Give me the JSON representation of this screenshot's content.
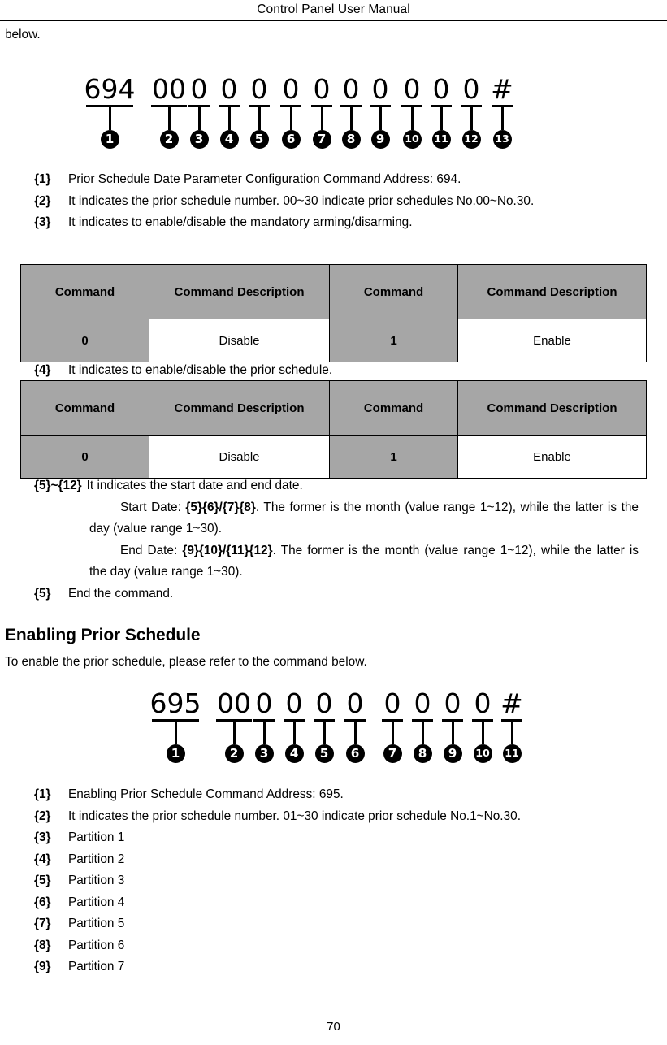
{
  "header": {
    "title": "Control Panel User Manual"
  },
  "intro": {
    "below_text": "below."
  },
  "diagram1": {
    "name": "prior-schedule-date-parameter-command",
    "segments": [
      {
        "digits": "694",
        "marker": "1"
      },
      {
        "digits": "00",
        "marker": "2"
      },
      {
        "digits": "0",
        "marker": "3"
      },
      {
        "digits": "0",
        "marker": "4"
      },
      {
        "digits": "0",
        "marker": "5"
      },
      {
        "digits": "0",
        "marker": "6"
      },
      {
        "digits": "0",
        "marker": "7"
      },
      {
        "digits": "0",
        "marker": "8"
      },
      {
        "digits": "0",
        "marker": "9"
      },
      {
        "digits": "0",
        "marker": "10"
      },
      {
        "digits": "0",
        "marker": "11"
      },
      {
        "digits": "0",
        "marker": "12"
      },
      {
        "digits": "#",
        "marker": "13"
      }
    ]
  },
  "list1": [
    {
      "tag": "{1}",
      "text": "Prior Schedule Date Parameter Configuration Command Address: 694."
    },
    {
      "tag": "{2}",
      "text": "It indicates the prior schedule number. 00~30 indicate prior schedules No.00~No.30."
    },
    {
      "tag": "{3}",
      "text": "It indicates to enable/disable the mandatory arming/disarming."
    }
  ],
  "table1": {
    "headers": [
      "Command",
      "Command Description",
      "Command",
      "Command Description"
    ],
    "rows": [
      [
        "0",
        "Disable",
        "1",
        "Enable"
      ]
    ]
  },
  "list2": [
    {
      "tag": "{4}",
      "text": "It indicates to enable/disable the prior schedule."
    }
  ],
  "table2": {
    "headers": [
      "Command",
      "Command Description",
      "Command",
      "Command Description"
    ],
    "rows": [
      [
        "0",
        "Disable",
        "1",
        "Enable"
      ]
    ]
  },
  "list3": {
    "range_tag": "{5}~{12}",
    "range_text": "It indicates the start date and end date.",
    "start_date_label": "Start Date: ",
    "start_date_codes": "{5}{6}/{7}{8}",
    "start_date_text": ". The former is the month (value range 1~12), while the latter is the day (value range 1~30).",
    "end_date_label": "End Date: ",
    "end_date_codes": "{9}{10}/{11}{12}",
    "end_date_text": ". The former is the month (value range 1~12), while the latter is the day (value range 1~30).",
    "final_tag": "{5}",
    "final_text": "End the command."
  },
  "section": {
    "heading": "Enabling Prior Schedule",
    "intro": "To enable the prior schedule, please refer to the command below."
  },
  "diagram2": {
    "name": "enabling-prior-schedule-command",
    "segments": [
      {
        "digits": "695",
        "marker": "1"
      },
      {
        "digits": "00",
        "marker": "2"
      },
      {
        "digits": "0",
        "marker": "3"
      },
      {
        "digits": "0",
        "marker": "4"
      },
      {
        "digits": "0",
        "marker": "5"
      },
      {
        "digits": "0",
        "marker": "6"
      },
      {
        "digits": "0",
        "marker": "7"
      },
      {
        "digits": "0",
        "marker": "8"
      },
      {
        "digits": "0",
        "marker": "9"
      },
      {
        "digits": "0",
        "marker": "10"
      },
      {
        "digits": "#",
        "marker": "11"
      }
    ]
  },
  "list4": [
    {
      "tag": "{1}",
      "text": "Enabling Prior Schedule Command Address: 695."
    },
    {
      "tag": "{2}",
      "text": "It indicates the prior schedule number. 01~30 indicate prior schedule No.1~No.30."
    },
    {
      "tag": "{3}",
      "text": "Partition 1"
    },
    {
      "tag": "{4}",
      "text": "Partition 2"
    },
    {
      "tag": "{5}",
      "text": "Partition 3"
    },
    {
      "tag": "{6}",
      "text": "Partition 4"
    },
    {
      "tag": "{7}",
      "text": "Partition 5"
    },
    {
      "tag": "{8}",
      "text": "Partition 6"
    },
    {
      "tag": "{9}",
      "text": "Partition 7"
    }
  ],
  "footer": {
    "page_number": "70"
  },
  "colors": {
    "table_shade": "#a6a6a6",
    "text": "#000000",
    "background": "#ffffff"
  }
}
